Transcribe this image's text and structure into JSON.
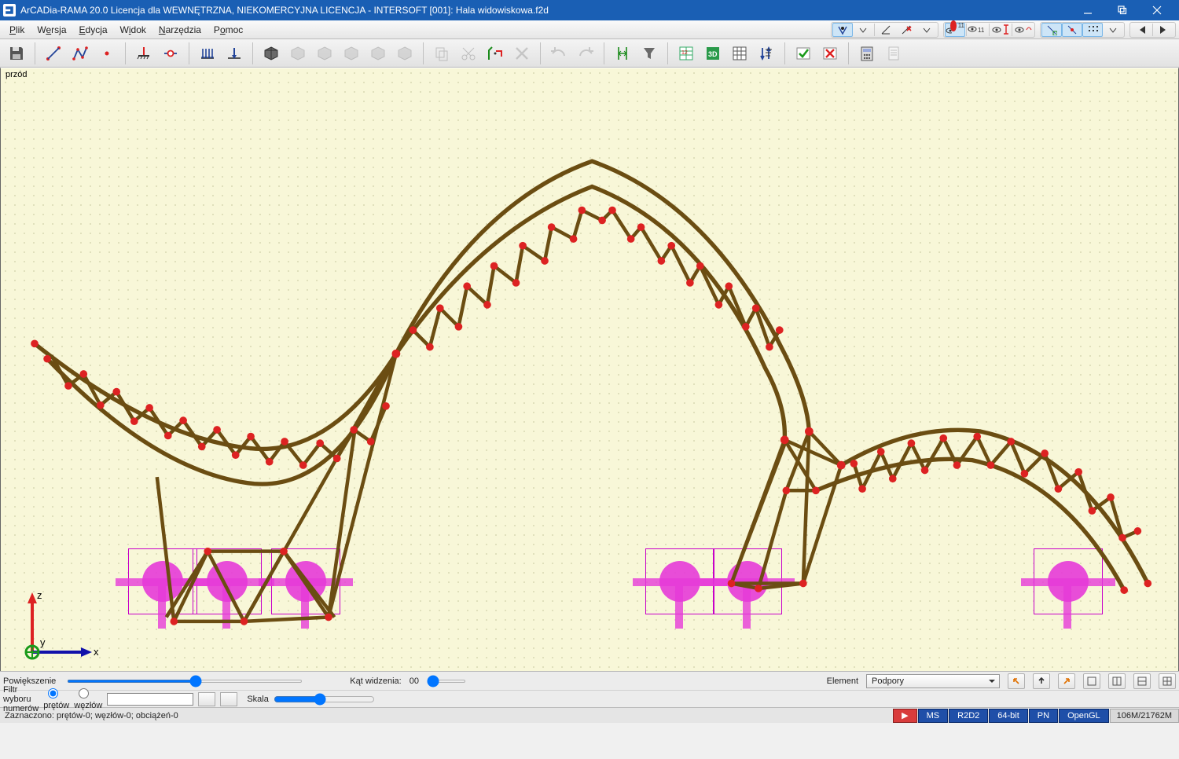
{
  "title": "ArCADia-RAMA 20.0 Licencja dla WEWNĘTRZNA, NIEKOMERCYJNA LICENCJA - INTERSOFT [001]: Hala widowiskowa.f2d",
  "menu": {
    "plik": "Plik",
    "wersja": "Wersja",
    "edycja": "Edycja",
    "widok": "Widok",
    "narzedzia": "Narzędzia",
    "pomoc": "Pomoc"
  },
  "view_label": "przód",
  "axes": {
    "x": "x",
    "y": "y",
    "z": "z"
  },
  "bottom": {
    "zoom_label": "Powiększenie",
    "angle_label": "Kąt widzenia:",
    "angle_value": "00",
    "element_label": "Element",
    "element_value": "Podpory",
    "scale_label": "Skala"
  },
  "filter": {
    "label": "Filtr wyboru numerów",
    "opt_pretow": "prętów",
    "opt_wezlow": "węzłów",
    "value": ""
  },
  "status": {
    "sel": "Zaznaczono: prętów-0; węzłów-0; obciążeń-0",
    "chips": [
      "MS",
      "R2D2",
      "64-bit",
      "PN",
      "OpenGL"
    ],
    "rec": "▶",
    "mem": "106M/21762M"
  }
}
